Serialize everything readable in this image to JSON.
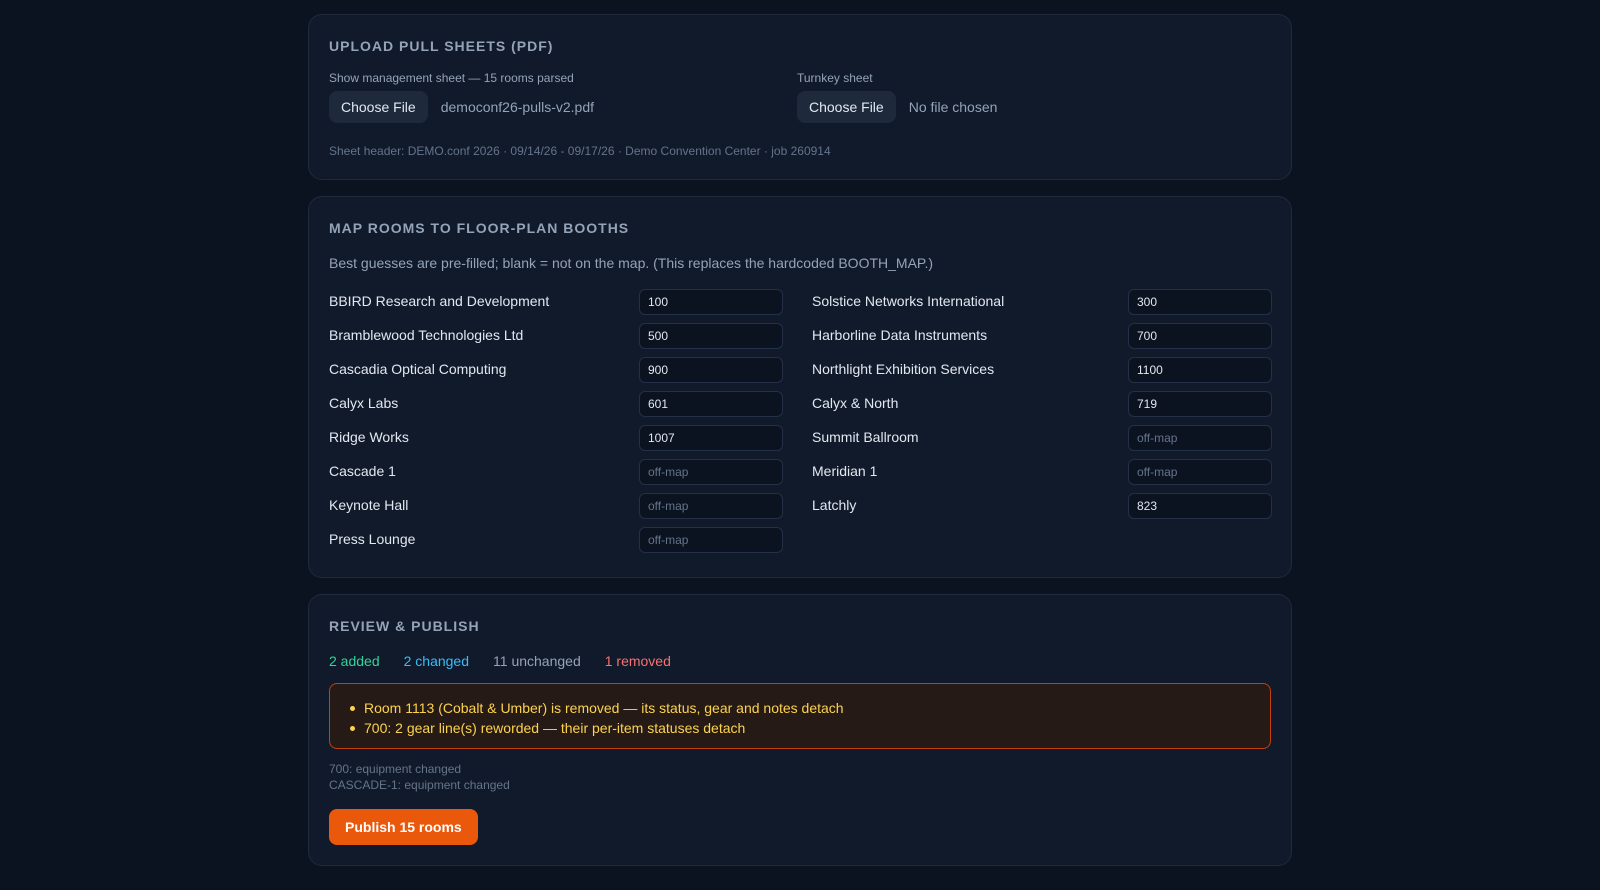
{
  "upload": {
    "title": "Upload pull sheets (PDF)",
    "show_management": {
      "label": "Show management sheet — 15 rooms parsed",
      "button": "Choose File",
      "file": "democonf26-pulls-v2.pdf"
    },
    "turnkey": {
      "label": "Turnkey sheet",
      "button": "Choose File",
      "file": "No file chosen"
    },
    "sheet_header": "Sheet header: DEMO.conf 2026 · 09/14/26 - 09/17/26 · Demo Convention Center · job 260914"
  },
  "map": {
    "title": "Map rooms to floor-plan booths",
    "description": "Best guesses are pre-filled; blank = not on the map. (This replaces the hardcoded BOOTH_MAP.)",
    "placeholder": "off-map",
    "left": [
      {
        "name": "BBIRD Research and Development",
        "booth": "100"
      },
      {
        "name": "Bramblewood Technologies Ltd",
        "booth": "500"
      },
      {
        "name": "Cascadia Optical Computing",
        "booth": "900"
      },
      {
        "name": "Calyx Labs",
        "booth": "601"
      },
      {
        "name": "Ridge Works",
        "booth": "1007"
      },
      {
        "name": "Cascade 1",
        "booth": ""
      },
      {
        "name": "Keynote Hall",
        "booth": ""
      },
      {
        "name": "Press Lounge",
        "booth": ""
      }
    ],
    "right": [
      {
        "name": "Solstice Networks International",
        "booth": "300"
      },
      {
        "name": "Harborline Data Instruments",
        "booth": "700"
      },
      {
        "name": "Northlight Exhibition Services",
        "booth": "1100"
      },
      {
        "name": "Calyx & North",
        "booth": "719"
      },
      {
        "name": "Summit Ballroom",
        "booth": ""
      },
      {
        "name": "Meridian 1",
        "booth": ""
      },
      {
        "name": "Latchly",
        "booth": "823"
      }
    ]
  },
  "review": {
    "title": "Review & publish",
    "added": "2 added",
    "changed": "2 changed",
    "unchanged": "11 unchanged",
    "removed": "1 removed",
    "warnings": [
      "Room 1113 (Cobalt & Umber) is removed — its status, gear and notes detach",
      "700: 2 gear line(s) reworded — their per-item statuses detach"
    ],
    "changes": [
      "700: equipment changed",
      "CASCADE-1: equipment changed"
    ],
    "publish_label": "Publish 15 rooms"
  },
  "colors": {
    "accent": "#ea580c",
    "added": "#34d399",
    "changed": "#38bdf8",
    "removed": "#f87171",
    "warning": "#fcd34d"
  }
}
